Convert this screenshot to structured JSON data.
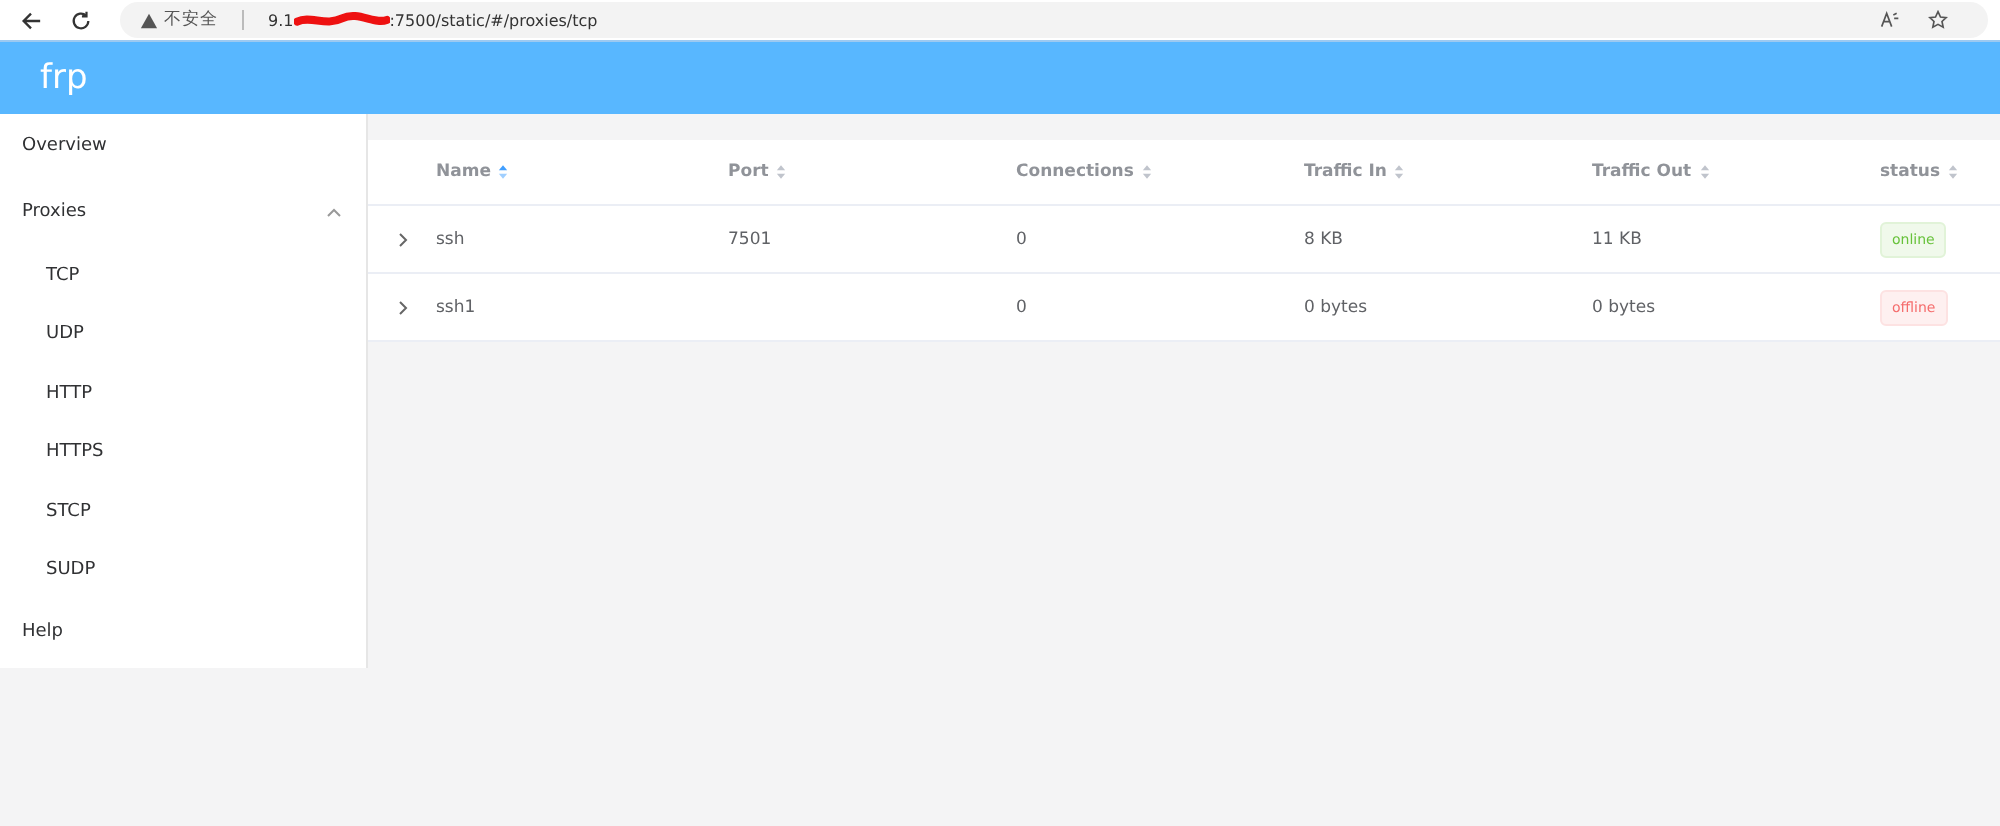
{
  "browser": {
    "security": "不安全",
    "url_start": "9.1",
    "url_end": ":7500/static/#/proxies/tcp"
  },
  "header": {
    "title": "frp"
  },
  "sidebar": {
    "items": [
      {
        "label": "Overview"
      },
      {
        "label": "Proxies",
        "expanded": true,
        "children": [
          {
            "label": "TCP"
          },
          {
            "label": "UDP"
          },
          {
            "label": "HTTP"
          },
          {
            "label": "HTTPS"
          },
          {
            "label": "STCP"
          },
          {
            "label": "SUDP"
          }
        ]
      },
      {
        "label": "Help"
      }
    ]
  },
  "table": {
    "columns": [
      {
        "label": "Name",
        "selected": true
      },
      {
        "label": "Port",
        "selected": false
      },
      {
        "label": "Connections",
        "selected": false
      },
      {
        "label": "Traffic In",
        "selected": false
      },
      {
        "label": "Traffic Out",
        "selected": false
      },
      {
        "label": "status",
        "selected": false
      }
    ],
    "rows": [
      {
        "expanded": false,
        "cells": [
          "ssh",
          "7501",
          "0",
          "8 KB",
          "11 KB"
        ],
        "status": {
          "kind": "online",
          "label": "online"
        }
      },
      {
        "expanded": false,
        "cells": [
          "ssh1",
          "",
          "0",
          "0 bytes",
          "0 bytes"
        ],
        "status": {
          "kind": "offline",
          "label": "offline"
        }
      }
    ]
  }
}
